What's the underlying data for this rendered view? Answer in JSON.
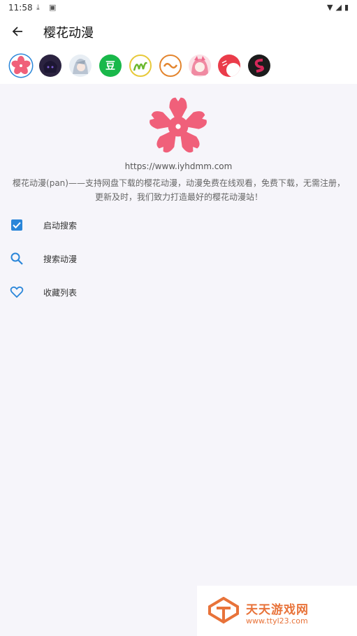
{
  "status_bar": {
    "time": "11:58"
  },
  "app_bar": {
    "title": "樱花动漫"
  },
  "sources": [
    {
      "icon": "sakura-source-icon"
    },
    {
      "icon": "anime-girl-source-icon"
    },
    {
      "icon": "silver-hair-source-icon"
    },
    {
      "icon": "douban-source-icon",
      "glyph": "豆"
    },
    {
      "icon": "m-logo-source-icon"
    },
    {
      "icon": "wave-logo-source-icon"
    },
    {
      "icon": "pink-hair-source-icon"
    },
    {
      "icon": "red-circle-source-icon"
    },
    {
      "icon": "s-logo-source-icon"
    }
  ],
  "site": {
    "url": "https://www.iyhdmm.com",
    "description": "樱花动漫(pan)——支持网盘下载的樱花动漫，动漫免费在线观看，免费下载，无需注册，更新及时，我们致力打造最好的樱花动漫站！"
  },
  "menu": [
    {
      "label": "启动搜索",
      "icon": "checkbox-icon"
    },
    {
      "label": "搜索动漫",
      "icon": "search-icon"
    },
    {
      "label": "收藏列表",
      "icon": "heart-icon"
    }
  ],
  "watermark": {
    "name": "天天游戏网",
    "url": "www.ttyl23.com"
  },
  "colors": {
    "accent": "#2a86d9",
    "sakura": "#f0607a",
    "watermark": "#e8733a"
  }
}
